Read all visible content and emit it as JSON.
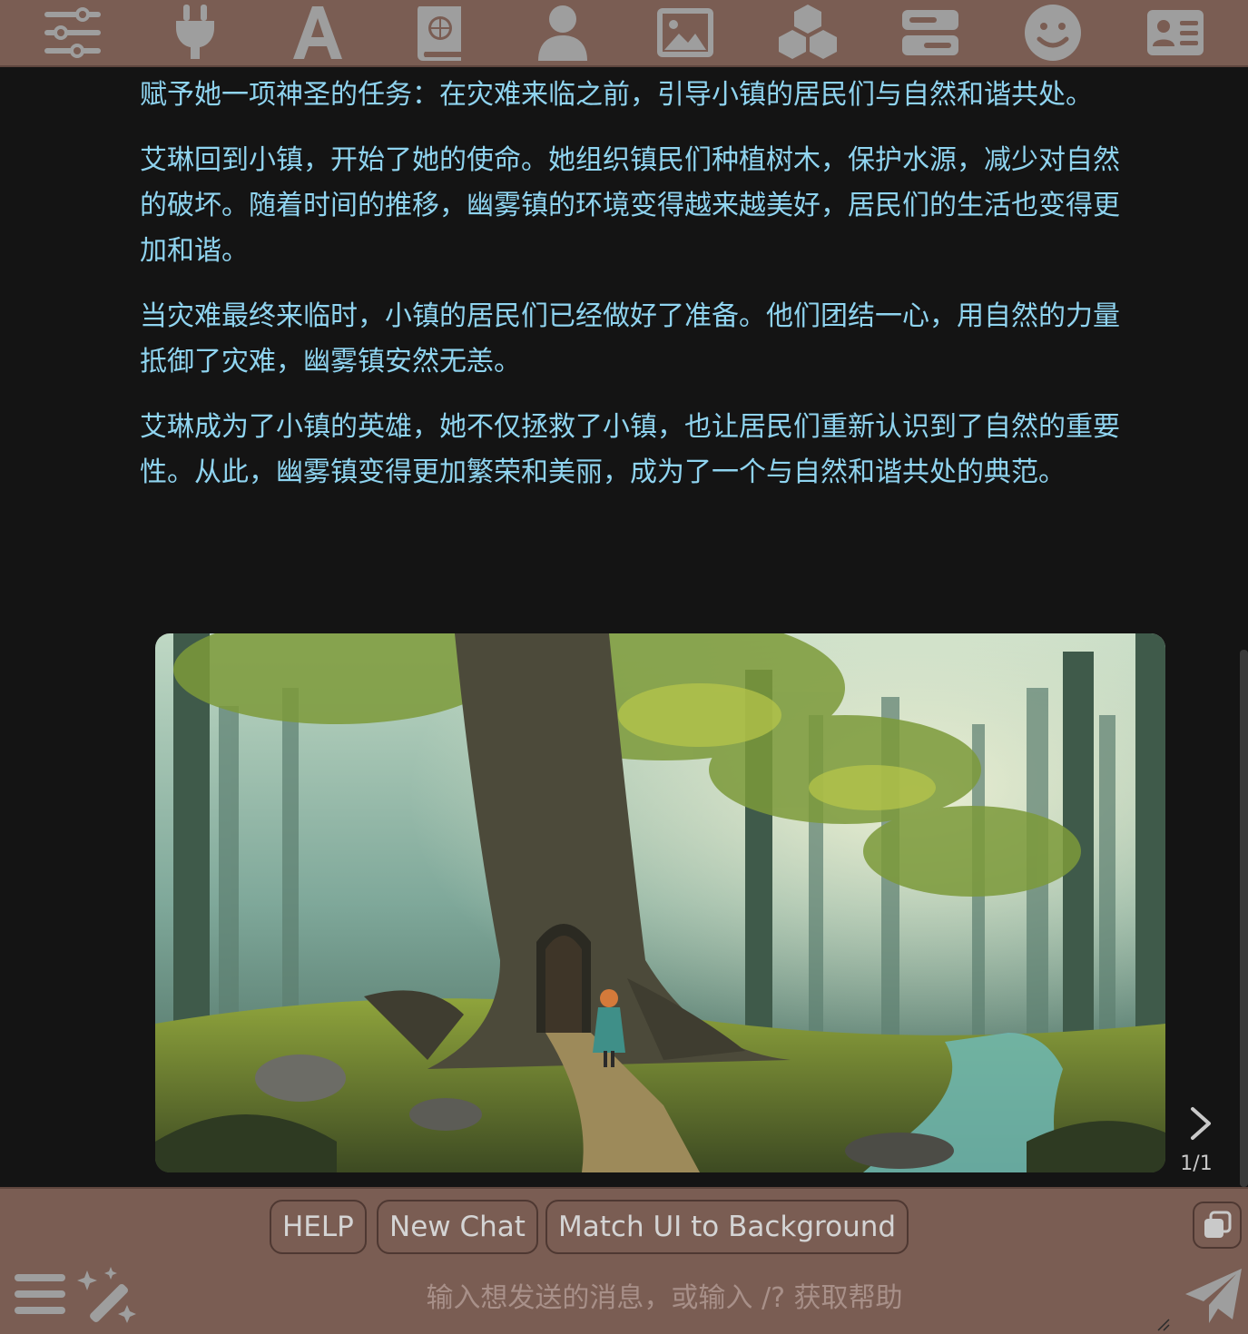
{
  "toolbar": {
    "icons": [
      "sliders-icon",
      "plug-icon",
      "font-icon",
      "world-book-icon",
      "user-icon",
      "image-icon",
      "cubes-icon",
      "server-icon",
      "smiley-icon",
      "id-card-icon"
    ]
  },
  "message": {
    "paragraphs": [
      "赋予她一项神圣的任务：在灾难来临之前，引导小镇的居民们与自然和谐共处。",
      "艾琳回到小镇，开始了她的使命。她组织镇民们种植树木，保护水源，减少对自然的破坏。随着时间的推移，幽雾镇的环境变得越来越美好，居民们的生活也变得更加和谐。",
      "当灾难最终来临时，小镇的居民们已经做好了准备。他们团结一心，用自然的力量抵御了灾难，幽雾镇安然无恙。",
      "艾琳成为了小镇的英雄，她不仅拯救了小镇，也让居民们重新认识到了自然的重要性。从此，幽雾镇变得更加繁荣和美丽，成为了一个与自然和谐共处的典范。"
    ],
    "text_color": "#8fd4f0"
  },
  "image_gallery": {
    "counter": "1/1",
    "next_icon": "chevron-right-icon"
  },
  "quick_replies": {
    "help": "HELP",
    "new_chat": "New Chat",
    "match_ui": "Match UI to Background"
  },
  "input": {
    "placeholder": "输入想发送的消息，或输入 /? 获取帮助",
    "value": ""
  },
  "colors": {
    "panel": "#7a5d53",
    "background": "#141414",
    "icon": "#9e9e9e"
  }
}
